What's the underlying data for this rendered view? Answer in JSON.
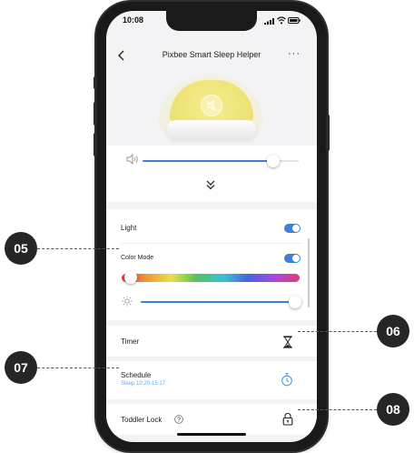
{
  "status_bar": {
    "time": "10:08"
  },
  "header": {
    "title": "Pixbee Smart Sleep Helper",
    "more": "···"
  },
  "volume": {
    "level": 0.84
  },
  "light": {
    "label": "Light",
    "enabled": true,
    "color_mode": {
      "label": "Color Mode",
      "enabled": true,
      "hue_position": 0.05
    },
    "brightness": 1.0
  },
  "timer": {
    "label": "Timer"
  },
  "schedule": {
    "label": "Schedule",
    "sub": "Sleep 10:20-15:17"
  },
  "toddler_lock": {
    "label": "Toddler Lock"
  },
  "callouts": [
    {
      "number": "05"
    },
    {
      "number": "06"
    },
    {
      "number": "07"
    },
    {
      "number": "08"
    }
  ],
  "colors": {
    "accent": "#3f7fd6",
    "lamp": "#f0e57a",
    "badge": "#262626",
    "schedule_text": "#6aa8e8"
  }
}
